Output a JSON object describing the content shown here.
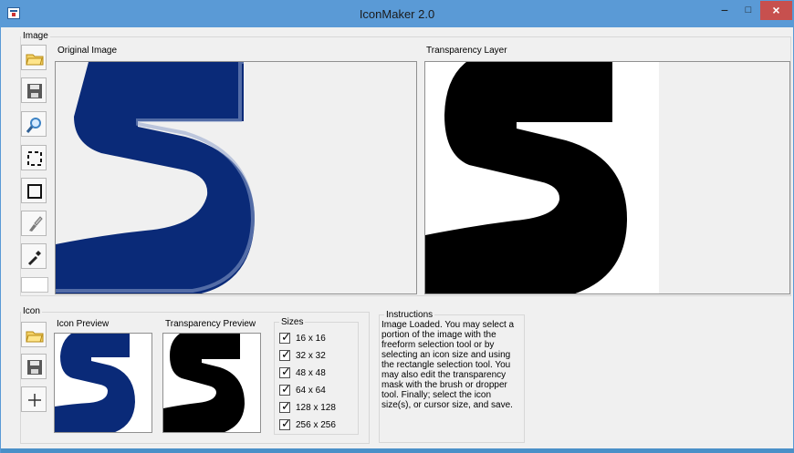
{
  "app": {
    "title": "IconMaker 2.0",
    "controls": [
      "minimize-icon",
      "maximize-icon",
      "close-icon"
    ]
  },
  "image_group": {
    "label": "Image",
    "original_title": "Original Image",
    "transparency_title": "Transparency Layer",
    "tools": [
      {
        "name": "folder-icon"
      },
      {
        "name": "save-icon"
      },
      {
        "name": "magnifier-icon"
      },
      {
        "name": "selection-icon"
      },
      {
        "name": "rectangle-icon"
      },
      {
        "name": "brush-icon"
      },
      {
        "name": "dropper-icon"
      }
    ],
    "selected_color": "#ffffff"
  },
  "icon_group": {
    "label": "Icon",
    "preview_title": "Icon Preview",
    "transparency_preview_title": "Transparency Preview",
    "sizes_label": "Sizes",
    "sizes": [
      "16 x 16",
      "32 x 32",
      "48 x 48",
      "64 x 64",
      "128 x 128",
      "256 x 256"
    ],
    "tools": [
      {
        "name": "folder-icon"
      },
      {
        "name": "save-icon"
      },
      {
        "name": "plus-icon"
      }
    ]
  },
  "instructions": {
    "label": "Instructions",
    "text": "Image Loaded. You may select a portion of the image with the freeform selection tool or by selecting an icon size and using the rectangle selection tool. You may also edit the transparency mask with the brush or dropper tool. Finally; select the icon size(s), or cursor size, and save."
  },
  "colors": {
    "accent": "#5a9ad6",
    "close": "#c7504e",
    "icon_blue": "#0a2a78",
    "mask_black": "#000000"
  }
}
